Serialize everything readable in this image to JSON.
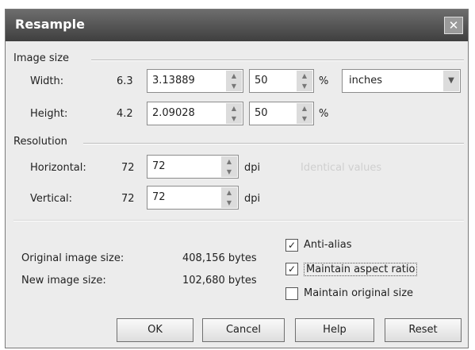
{
  "dialog": {
    "title": "Resample",
    "close_icon": "close-icon"
  },
  "image_size": {
    "section_label": "Image size",
    "width": {
      "label": "Width:",
      "original": "6.3",
      "value": "3.13889",
      "percent": "50",
      "percent_symbol": "%"
    },
    "height": {
      "label": "Height:",
      "original": "4.2",
      "value": "2.09028",
      "percent": "50",
      "percent_symbol": "%"
    },
    "units": {
      "selected": "inches"
    }
  },
  "resolution": {
    "section_label": "Resolution",
    "horizontal": {
      "label": "Horizontal:",
      "original": "72",
      "value": "72",
      "unit": "dpi"
    },
    "vertical": {
      "label": "Vertical:",
      "original": "72",
      "value": "72",
      "unit": "dpi"
    },
    "identical_values_label": "Identical values"
  },
  "info": {
    "original_label": "Original image size:",
    "original_value": "408,156 bytes",
    "new_label": "New image size:",
    "new_value": "102,680 bytes"
  },
  "options": {
    "anti_alias": {
      "label": "Anti-alias",
      "checked": true
    },
    "maintain_aspect": {
      "label": "Maintain aspect ratio",
      "checked": true
    },
    "maintain_size": {
      "label": "Maintain original size",
      "checked": false
    }
  },
  "buttons": {
    "ok": "OK",
    "cancel": "Cancel",
    "help": "Help",
    "reset": "Reset"
  }
}
